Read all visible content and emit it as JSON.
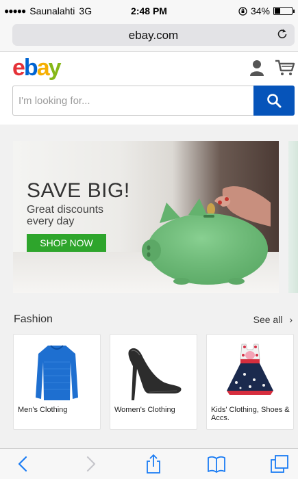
{
  "status_bar": {
    "carrier": "Saunalahti",
    "network": "3G",
    "time": "2:48 PM",
    "battery": "34%",
    "battery_level": 0.34
  },
  "browser": {
    "url": "ebay.com",
    "reload_icon": "reload-icon"
  },
  "header": {
    "logo": {
      "e": "e",
      "b": "b",
      "a": "a",
      "y": "y"
    },
    "icons": [
      "user-icon",
      "cart-icon"
    ]
  },
  "search": {
    "placeholder": "I'm looking for...",
    "button_icon": "search-icon"
  },
  "banner": {
    "headline": "SAVE BIG!",
    "subtext": "Great discounts every day",
    "cta": "SHOP NOW",
    "cta_color": "#2ea52c"
  },
  "fashion": {
    "title": "Fashion",
    "see_all": "See all",
    "items": [
      {
        "label": "Men's Clothing"
      },
      {
        "label": "Women's Clothing"
      },
      {
        "label": "Kids' Clothing, Shoes & Accs."
      }
    ]
  },
  "toolbar": {
    "icons": [
      "back-icon",
      "forward-icon",
      "share-icon",
      "bookmarks-icon",
      "tabs-icon"
    ]
  },
  "colors": {
    "ebay_red": "#e53238",
    "ebay_blue": "#0064d2",
    "ebay_yellow": "#f5af02",
    "ebay_green": "#86b817",
    "search_button": "#0654ba",
    "ios_blue": "#1a7cf4"
  }
}
